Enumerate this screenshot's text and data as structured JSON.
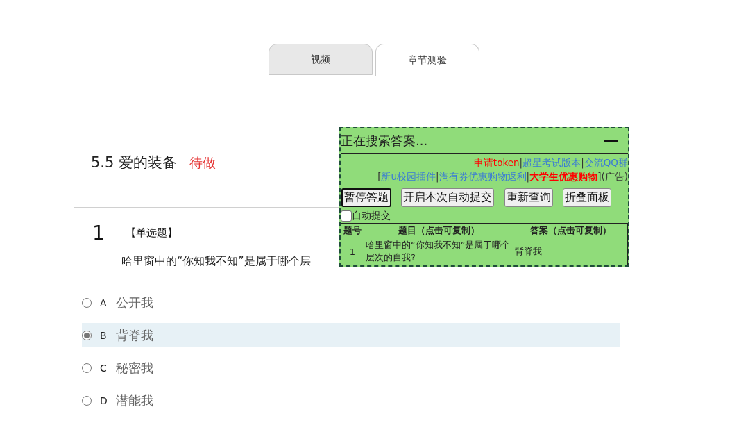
{
  "tabs": [
    {
      "label": "视频",
      "selected": false
    },
    {
      "label": "章节测验",
      "selected": true
    }
  ],
  "chapter": {
    "title": "5.5 爱的装备",
    "status": "待做"
  },
  "question": {
    "number": "1",
    "type": "【单选题】",
    "text": "哈里窗中的“你知我不知”是属于哪个层"
  },
  "options": [
    {
      "letter": "A",
      "text": "公开我",
      "selected": false
    },
    {
      "letter": "B",
      "text": "背脊我",
      "selected": true
    },
    {
      "letter": "C",
      "text": "秘密我",
      "selected": false
    },
    {
      "letter": "D",
      "text": "潜能我",
      "selected": false
    }
  ],
  "panel": {
    "title": "正在搜索答案...",
    "link_lines": [
      [
        {
          "kind": "link",
          "text": "申请token",
          "color": "#ff0000",
          "bold": false
        },
        {
          "kind": "sep",
          "text": "|"
        },
        {
          "kind": "link",
          "text": "超星考试版本",
          "color": "#3a7bd5",
          "bold": false
        },
        {
          "kind": "sep",
          "text": "|"
        },
        {
          "kind": "link",
          "text": "交流QQ群",
          "color": "#3a7bd5",
          "bold": false
        }
      ],
      [
        {
          "kind": "sep",
          "text": "["
        },
        {
          "kind": "link",
          "text": "新u校园插件",
          "color": "#3a7bd5",
          "bold": false
        },
        {
          "kind": "sep",
          "text": "|"
        },
        {
          "kind": "link",
          "text": "淘有券优惠购物返利",
          "color": "#3a7bd5",
          "bold": false
        },
        {
          "kind": "sep",
          "text": "|"
        },
        {
          "kind": "link",
          "text": "大学生优惠购物",
          "color": "#ff0000",
          "bold": true
        },
        {
          "kind": "sep",
          "text": "]"
        },
        {
          "kind": "sep",
          "text": "(广告)"
        }
      ]
    ],
    "buttons": [
      {
        "label": "暂停答题",
        "focused": true
      },
      {
        "label": "开启本次自动提交",
        "focused": false
      },
      {
        "label": "重新查询",
        "focused": false
      },
      {
        "label": "折叠面板",
        "focused": false
      }
    ],
    "auto_submit": {
      "label": "自动提交",
      "checked": false
    },
    "table": {
      "columns": [
        "题号",
        "题目（点击可复制）",
        "答案（点击可复制）"
      ],
      "rows": [
        {
          "number": "1",
          "question": "哈里窗中的“你知我不知”是属于哪个层次的自我?",
          "answer": "背脊我"
        }
      ]
    }
  }
}
